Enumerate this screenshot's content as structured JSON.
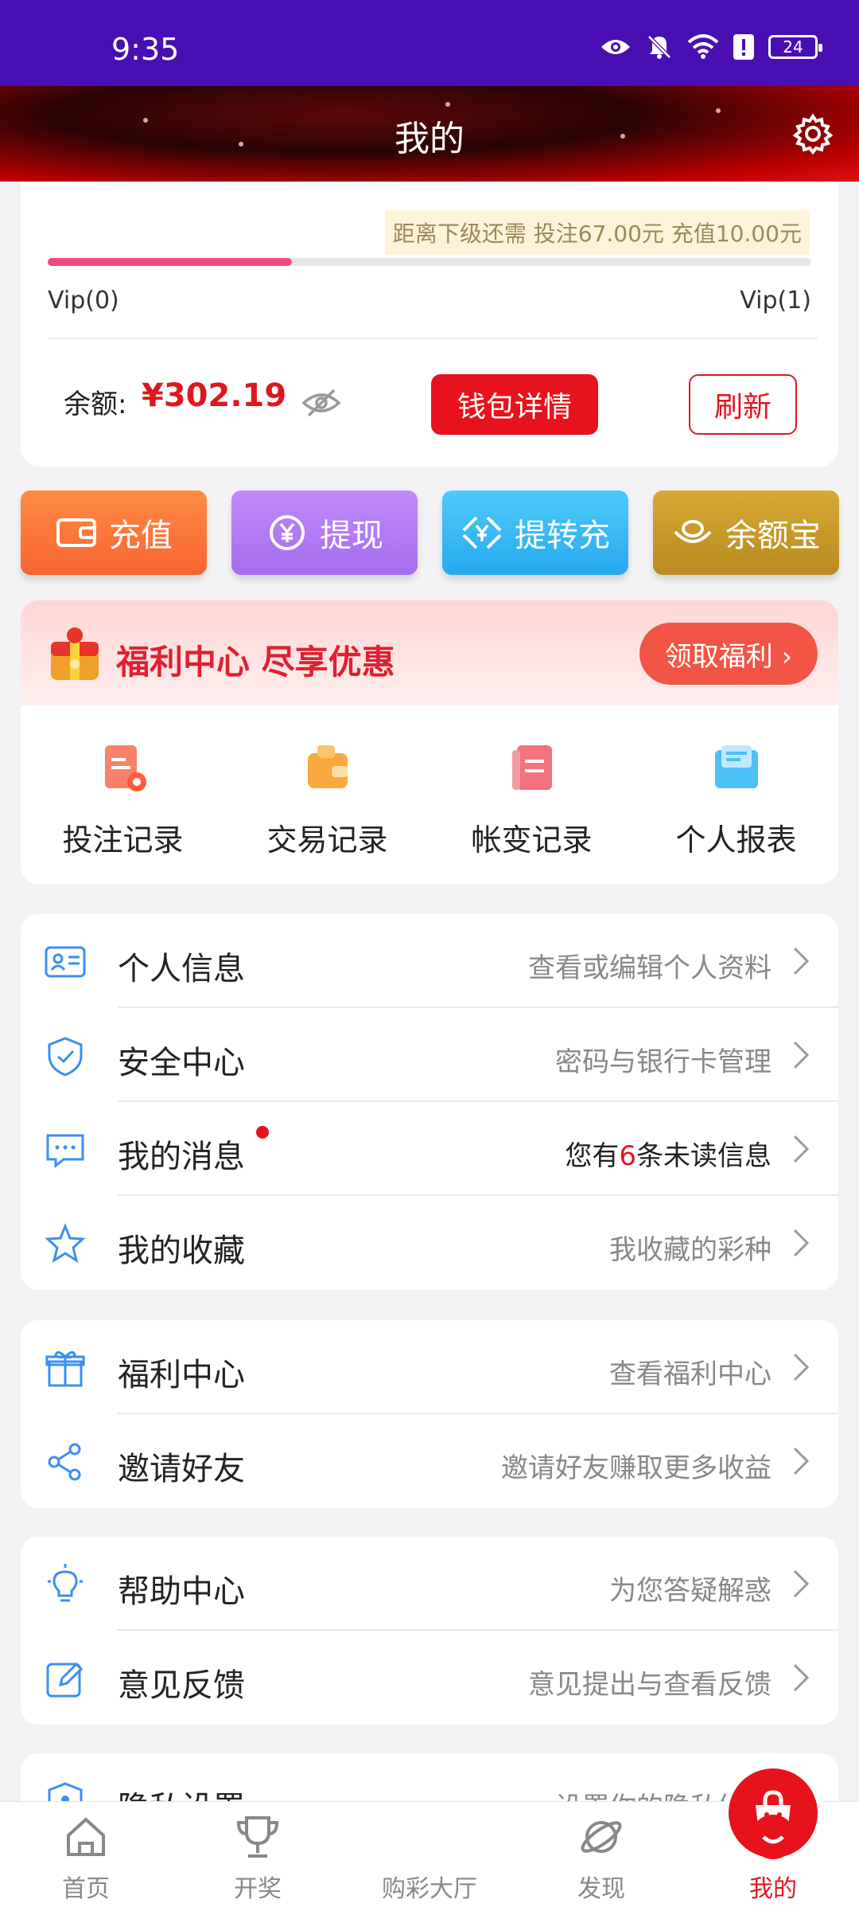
{
  "status_bar": {
    "time": "9:35",
    "battery": "24"
  },
  "header": {
    "title": "我的"
  },
  "vip": {
    "need_text": "距离下级还需  投注67.00元  充值10.00元",
    "progress_percent": 32,
    "current_level": "Vip(0)",
    "next_level": "Vip(1)"
  },
  "balance": {
    "label": "余额:",
    "value": "¥302.19",
    "wallet_label": "钱包详情",
    "refresh_label": "刷新"
  },
  "actions": [
    {
      "label": "充值",
      "icon": "wallet-icon",
      "color": "#fb7a3c"
    },
    {
      "label": "提现",
      "icon": "yen-circle-icon",
      "color": "#b57cf2"
    },
    {
      "label": "提转充",
      "icon": "exchange-icon",
      "color": "#3bb8f5"
    },
    {
      "label": "余额宝",
      "icon": "ingot-icon",
      "color": "#c99a2a"
    }
  ],
  "welfare": {
    "title": "福利中心 尽享优惠",
    "button_label": "领取福利 ›",
    "records": [
      {
        "label": "投注记录",
        "icon": "bet-record-icon"
      },
      {
        "label": "交易记录",
        "icon": "transaction-record-icon"
      },
      {
        "label": "帐变记录",
        "icon": "account-change-icon"
      },
      {
        "label": "个人报表",
        "icon": "report-icon"
      }
    ]
  },
  "menu_groups": [
    [
      {
        "label": "个人信息",
        "desc": "查看或编辑个人资料",
        "icon": "id-card-icon"
      },
      {
        "label": "安全中心",
        "desc": "密码与银行卡管理",
        "icon": "shield-icon"
      },
      {
        "label": "我的消息",
        "desc_prefix": "您有",
        "desc_count": "6",
        "desc_suffix": "条未读信息",
        "icon": "message-icon"
      },
      {
        "label": "我的收藏",
        "desc": "我收藏的彩种",
        "icon": "star-icon"
      }
    ],
    [
      {
        "label": "福利中心",
        "desc": "查看福利中心",
        "icon": "gift-icon"
      },
      {
        "label": "邀请好友",
        "desc": "邀请好友赚取更多收益",
        "icon": "share-icon"
      }
    ],
    [
      {
        "label": "帮助中心",
        "desc": "为您答疑解惑",
        "icon": "bulb-icon"
      },
      {
        "label": "意见反馈",
        "desc": "意见提出与查看反馈",
        "icon": "edit-icon"
      }
    ],
    [
      {
        "label": "隐私设置",
        "desc": "设置你的隐私信息",
        "icon": "privacy-icon"
      }
    ]
  ],
  "tabbar": [
    {
      "label": "首页",
      "icon": "home-icon"
    },
    {
      "label": "开奖",
      "icon": "trophy-icon"
    },
    {
      "label": "购彩大厅",
      "icon": "shopping-bag-icon"
    },
    {
      "label": "发现",
      "icon": "planet-icon"
    },
    {
      "label": "我的",
      "icon": "profile-icon",
      "active": true
    }
  ]
}
